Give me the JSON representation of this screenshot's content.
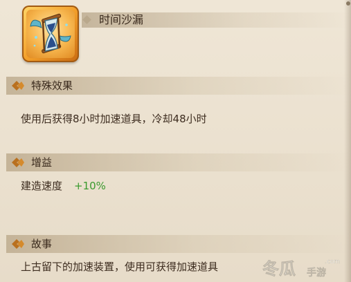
{
  "item": {
    "name": "时间沙漏",
    "icon": "hourglass-icon"
  },
  "sections": {
    "special_effect": {
      "label": "特殊效果",
      "text": "使用后获得8小时加速道具，冷却48小时"
    },
    "buff": {
      "label": "增益",
      "stat_name": "建造速度",
      "stat_value": "+10%"
    },
    "story": {
      "label": "故事",
      "text": "上古留下的加速装置，使用可获得加速道具"
    }
  },
  "watermark": {
    "main": "冬瓜",
    "sub": "手游",
    "domain": ".com"
  },
  "colors": {
    "background": "#e9dfcd",
    "positive": "#3a9a2e",
    "text": "#3d2c1f"
  }
}
